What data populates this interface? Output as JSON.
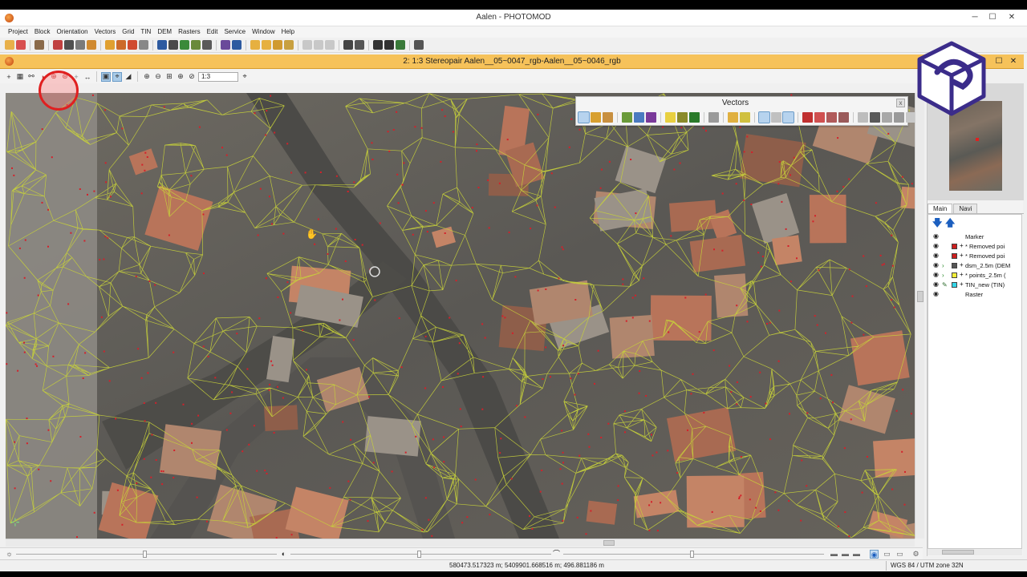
{
  "app": {
    "title": "Aalen - PHOTOMOD",
    "controls": {
      "minimize": "─",
      "maximize": "☐",
      "close": "✕"
    }
  },
  "menu": [
    "Project",
    "Block",
    "Orientation",
    "Vectors",
    "Grid",
    "TIN",
    "DEM",
    "Rasters",
    "Edit",
    "Service",
    "Window",
    "Help"
  ],
  "stereo_window": {
    "title": "2: 1:3 Stereopair Aalen__05~0047_rgb-Aalen__05~0046_rgb",
    "zoom_value": "1:3"
  },
  "vectors_panel": {
    "title": "Vectors",
    "close": "x"
  },
  "right_panel": {
    "tabs": [
      "Main",
      "Navi"
    ],
    "layers": [
      {
        "name": "Marker",
        "color": "",
        "editable": false,
        "has_plus": false
      },
      {
        "name": "* Removed poi",
        "color": "#cc1f1f",
        "editable": false,
        "has_plus": true
      },
      {
        "name": "* Removed poi",
        "color": "#cc1f1f",
        "editable": false,
        "has_plus": true
      },
      {
        "name": "dsm_2.5m (DEM",
        "color": "#555555",
        "editable": true,
        "has_plus": true
      },
      {
        "name": "* points_2.5m (",
        "color": "#f2ee3a",
        "editable": true,
        "has_plus": true
      },
      {
        "name": "TIN_new (TIN)",
        "color": "#35d6e8",
        "editable": true,
        "has_plus": true
      },
      {
        "name": "Raster",
        "color": "",
        "editable": false,
        "has_plus": false
      }
    ]
  },
  "status": {
    "coords": "580473.517323 m; 5409901.668516 m; 496.881186 m",
    "crs": "WGS 84 / UTM zone 32N"
  },
  "colors": {
    "tin_lines": "#c8d23a",
    "points": "#d4202a",
    "stereo_title_bg": "#f6c25a",
    "highlight": "#e02020"
  }
}
